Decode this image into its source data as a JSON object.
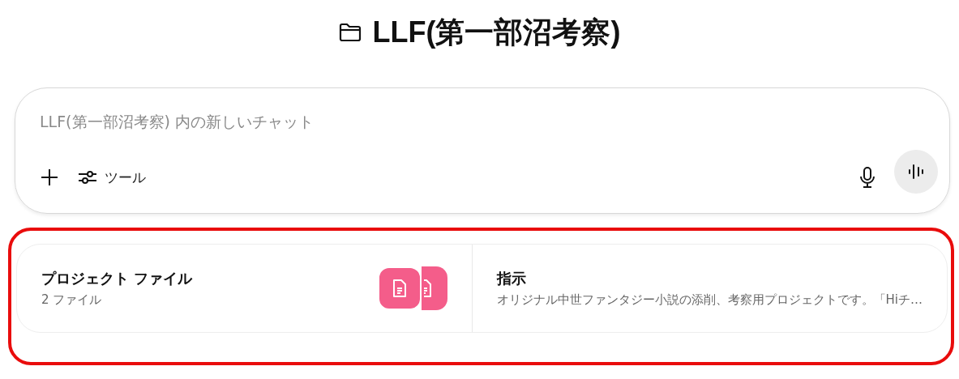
{
  "project": {
    "title": "LLF(第一部沼考察)"
  },
  "composer": {
    "placeholder": "LLF(第一部沼考察) 内の新しいチャット",
    "tools_label": "ツール"
  },
  "panels": {
    "highlighted": true,
    "files": {
      "title": "プロジェクト ファイル",
      "count": "2 ファイル",
      "color": "#f45d8a"
    },
    "instructions": {
      "title": "指示",
      "text": "オリジナル中世ファンタジー小説の添削、考察用プロジェクトです。「Hiチ…"
    }
  }
}
